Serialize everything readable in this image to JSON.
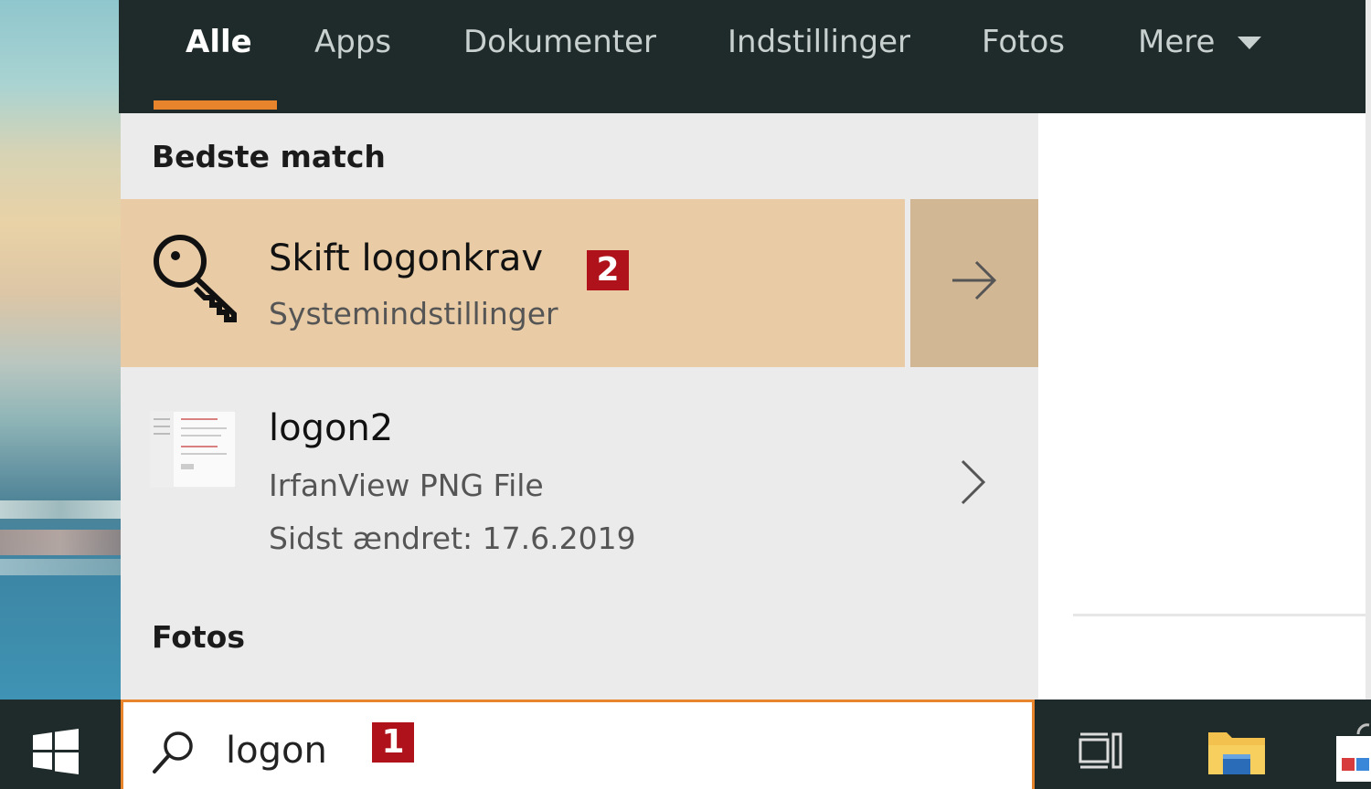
{
  "tabs": {
    "all": "Alle",
    "apps": "Apps",
    "documents": "Dokumenter",
    "settings": "Indstillinger",
    "photos": "Fotos",
    "more": "Mere"
  },
  "sections": {
    "best_match": "Bedste match",
    "photos": "Fotos"
  },
  "best_result": {
    "title": "Skift logonkrav",
    "subtitle": "Systemindstillinger",
    "icon": "key-icon"
  },
  "file_result": {
    "title": "logon2",
    "type": "IrfanView PNG File",
    "modified": "Sidst ændret: 17.6.2019",
    "icon": "document-thumbnail"
  },
  "search": {
    "query": "logon",
    "icon": "search-icon"
  },
  "annotations": {
    "step1": "1",
    "step2": "2"
  },
  "colors": {
    "accent": "#e8852c",
    "highlight": "#e9cca6",
    "dark_bar": "#1f2b2a",
    "badge": "#b0121b"
  }
}
